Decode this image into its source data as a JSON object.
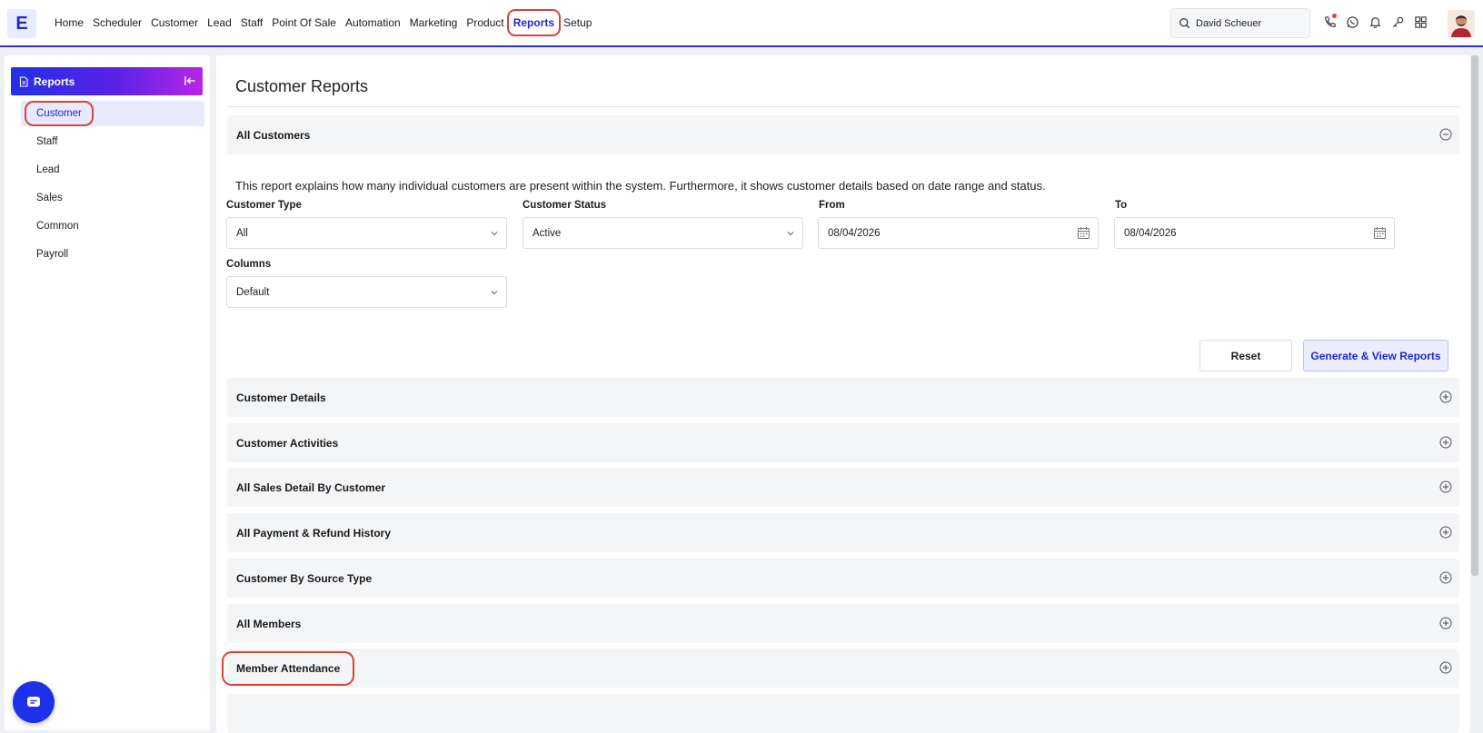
{
  "logo": "E",
  "nav": [
    {
      "label": "Home"
    },
    {
      "label": "Scheduler"
    },
    {
      "label": "Customer"
    },
    {
      "label": "Lead"
    },
    {
      "label": "Staff"
    },
    {
      "label": "Point Of Sale"
    },
    {
      "label": "Automation"
    },
    {
      "label": "Marketing"
    },
    {
      "label": "Product"
    },
    {
      "label": "Reports"
    },
    {
      "label": "Setup"
    }
  ],
  "search": {
    "value": "David Scheuer"
  },
  "sidebar": {
    "title": "Reports",
    "items": [
      {
        "label": "Customer"
      },
      {
        "label": "Staff"
      },
      {
        "label": "Lead"
      },
      {
        "label": "Sales"
      },
      {
        "label": "Common"
      },
      {
        "label": "Payroll"
      }
    ]
  },
  "main": {
    "title": "Customer Reports",
    "open_section": {
      "title": "All Customers",
      "description": "This report explains how many individual customers are present within the system. Furthermore, it shows customer details based on date range and status.",
      "fields": {
        "customer_type": {
          "label": "Customer Type",
          "value": "All"
        },
        "customer_status": {
          "label": "Customer Status",
          "value": "Active"
        },
        "from": {
          "label": "From",
          "value": "08/04/2026"
        },
        "to": {
          "label": "To",
          "value": "08/04/2026"
        },
        "columns": {
          "label": "Columns",
          "value": "Default"
        }
      },
      "reset_label": "Reset",
      "generate_label": "Generate & View Reports"
    },
    "sections": [
      {
        "label": "Customer Details"
      },
      {
        "label": "Customer Activities"
      },
      {
        "label": "All Sales Detail By Customer"
      },
      {
        "label": "All Payment & Refund History"
      },
      {
        "label": "Customer By Source Type"
      },
      {
        "label": "All Members"
      },
      {
        "label": "Member Attendance"
      }
    ]
  },
  "colors": {
    "accent": "#1f26d6",
    "highlight": "#d64538"
  }
}
